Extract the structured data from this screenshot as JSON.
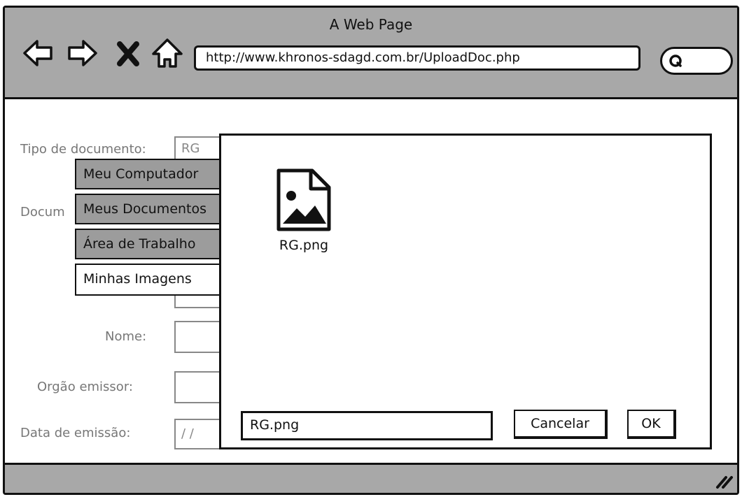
{
  "browser": {
    "page_title": "A Web Page",
    "url": "http://www.khronos-sdagd.com.br/UploadDoc.php",
    "icons": [
      "back-icon",
      "forward-icon",
      "stop-icon",
      "home-icon",
      "search-icon",
      "resize-grip-icon"
    ]
  },
  "form": {
    "tipo_label": "Tipo de documento:",
    "tipo_value": "RG",
    "documento_label": "Docum",
    "nome_label": "Nome:",
    "orgao_label": "Orgão emissor:",
    "data_label": "Data de emissão:",
    "data_value": " /  /"
  },
  "locations": [
    {
      "label": "Meu Computador"
    },
    {
      "label": "Meus Documentos"
    },
    {
      "label": "Área de Trabalho"
    },
    {
      "label": "Minhas Imagens"
    }
  ],
  "dialog": {
    "file_name": "RG.png",
    "filename_value": "RG.png",
    "cancel_label": "Cancelar",
    "ok_label": "OK"
  }
}
